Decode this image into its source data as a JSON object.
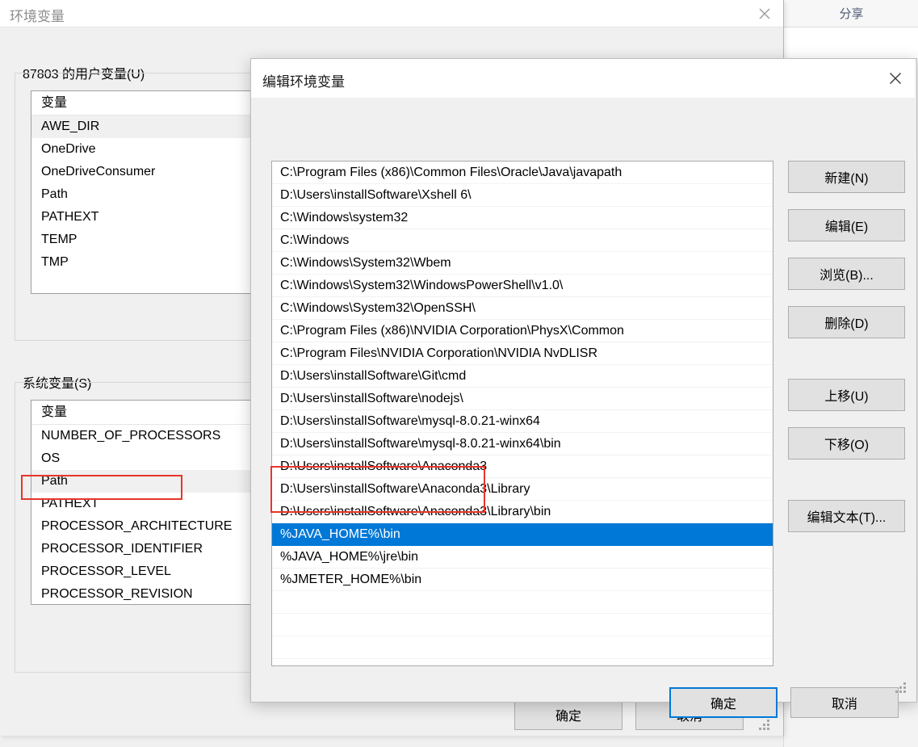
{
  "explorer": {
    "tab_label": "分享"
  },
  "env_window": {
    "title": "环境变量",
    "close_icon": "close-icon",
    "user_group_label": "87803 的用户变量(U)",
    "system_group_label": "系统变量(S)",
    "column_header": "变量",
    "user_variables": [
      "AWE_DIR",
      "OneDrive",
      "OneDriveConsumer",
      "Path",
      "PATHEXT",
      "TEMP",
      "TMP"
    ],
    "user_selected_index": 0,
    "system_variables": [
      "NUMBER_OF_PROCESSORS",
      "OS",
      "Path",
      "PATHEXT",
      "PROCESSOR_ARCHITECTURE",
      "PROCESSOR_IDENTIFIER",
      "PROCESSOR_LEVEL",
      "PROCESSOR_REVISION"
    ],
    "system_selected_index": 2,
    "ok_label": "确定",
    "cancel_label": "取消"
  },
  "edit_dialog": {
    "title": "编辑环境变量",
    "close_icon": "close-icon",
    "path_entries": [
      "C:\\Program Files (x86)\\Common Files\\Oracle\\Java\\javapath",
      "D:\\Users\\installSoftware\\Xshell 6\\",
      "C:\\Windows\\system32",
      "C:\\Windows",
      "C:\\Windows\\System32\\Wbem",
      "C:\\Windows\\System32\\WindowsPowerShell\\v1.0\\",
      "C:\\Windows\\System32\\OpenSSH\\",
      "C:\\Program Files (x86)\\NVIDIA Corporation\\PhysX\\Common",
      "C:\\Program Files\\NVIDIA Corporation\\NVIDIA NvDLISR",
      "D:\\Users\\installSoftware\\Git\\cmd",
      "D:\\Users\\installSoftware\\nodejs\\",
      "D:\\Users\\installSoftware\\mysql-8.0.21-winx64",
      "D:\\Users\\installSoftware\\mysql-8.0.21-winx64\\bin",
      "D:\\Users\\installSoftware\\Anaconda3",
      "D:\\Users\\installSoftware\\Anaconda3\\Library",
      "D:\\Users\\installSoftware\\Anaconda3\\Library\\bin",
      "%JAVA_HOME%\\bin",
      "%JAVA_HOME%\\jre\\bin",
      "%JMETER_HOME%\\bin"
    ],
    "selected_index": 16,
    "side_buttons": [
      "新建(N)",
      "编辑(E)",
      "浏览(B)...",
      "删除(D)",
      "上移(U)",
      "下移(O)",
      "编辑文本(T)..."
    ],
    "ok_label": "确定",
    "cancel_label": "取消"
  },
  "colors": {
    "selection_blue": "#0078d7",
    "annotation_red": "#e8352b",
    "window_gray": "#f0f0f0",
    "button_face": "#e1e1e1"
  }
}
